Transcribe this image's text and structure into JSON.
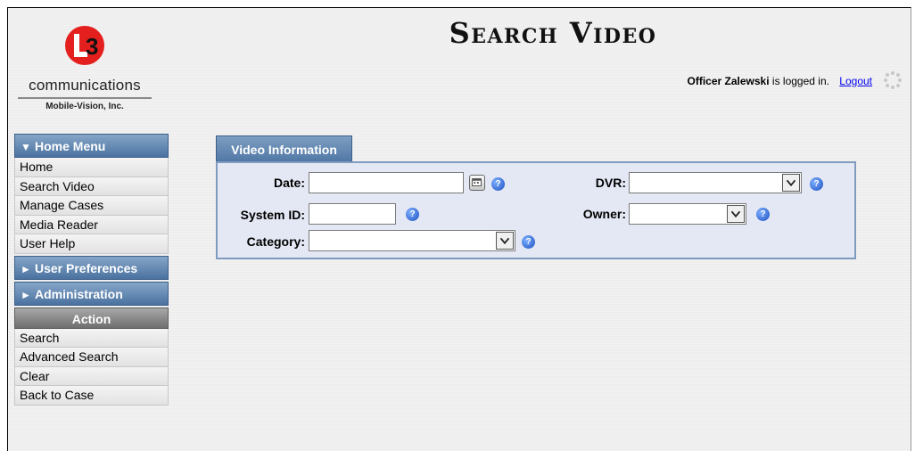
{
  "page": {
    "title": "Search Video"
  },
  "logo": {
    "mark_text": "3",
    "company": "communications",
    "division": "Mobile-Vision, Inc."
  },
  "user": {
    "name": "Officer Zalewski",
    "status_text": "is logged in.",
    "logout_label": "Logout"
  },
  "sidebar": {
    "home_menu": {
      "title": "Home Menu",
      "items": [
        "Home",
        "Search Video",
        "Manage Cases",
        "Media Reader",
        "User Help"
      ]
    },
    "user_preferences": {
      "title": "User Preferences"
    },
    "administration": {
      "title": "Administration"
    },
    "action": {
      "title": "Action",
      "items": [
        "Search",
        "Advanced Search",
        "Clear",
        "Back to Case"
      ]
    }
  },
  "video_info": {
    "tab_label": "Video Information",
    "date": {
      "label": "Date:",
      "value": ""
    },
    "system_id": {
      "label": "System ID:",
      "value": ""
    },
    "category": {
      "label": "Category:",
      "value": ""
    },
    "dvr": {
      "label": "DVR:",
      "value": ""
    },
    "owner": {
      "label": "Owner:",
      "value": ""
    }
  },
  "colors": {
    "menu_header": "#4f77a4",
    "action_header": "#7a7a7a",
    "link": "#0000ee"
  }
}
